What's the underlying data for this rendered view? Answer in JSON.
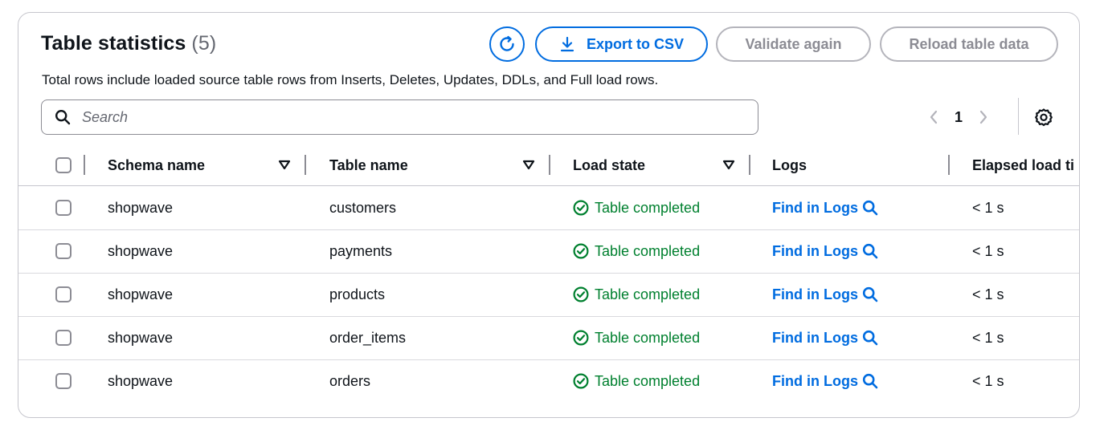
{
  "header": {
    "title": "Table statistics",
    "count": "(5)",
    "description": "Total rows include loaded source table rows from Inserts, Deletes, Updates, DDLs, and Full load rows."
  },
  "actions": {
    "refresh_icon": "refresh-icon",
    "export_label": "Export to CSV",
    "validate_label": "Validate again",
    "reload_label": "Reload table data"
  },
  "search": {
    "placeholder": "Search",
    "value": ""
  },
  "pagination": {
    "current_page": "1"
  },
  "table": {
    "columns": [
      "Schema name",
      "Table name",
      "Load state",
      "Logs",
      "Elapsed load ti"
    ],
    "rows": [
      {
        "schema": "shopwave",
        "table": "customers",
        "state": "Table completed",
        "logs": "Find in Logs",
        "elapsed": "< 1 s"
      },
      {
        "schema": "shopwave",
        "table": "payments",
        "state": "Table completed",
        "logs": "Find in Logs",
        "elapsed": "< 1 s"
      },
      {
        "schema": "shopwave",
        "table": "products",
        "state": "Table completed",
        "logs": "Find in Logs",
        "elapsed": "< 1 s"
      },
      {
        "schema": "shopwave",
        "table": "order_items",
        "state": "Table completed",
        "logs": "Find in Logs",
        "elapsed": "< 1 s"
      },
      {
        "schema": "shopwave",
        "table": "orders",
        "state": "Table completed",
        "logs": "Find in Logs",
        "elapsed": "< 1 s"
      }
    ]
  },
  "colors": {
    "primary": "#006ce0",
    "success": "#00802f",
    "disabled": "#8c8c94",
    "text": "#0f141a"
  }
}
